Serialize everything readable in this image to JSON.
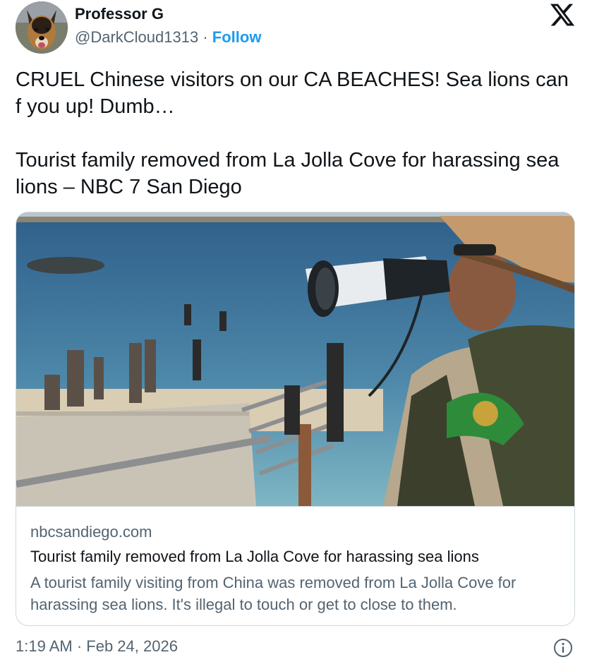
{
  "author": {
    "display_name": "Professor G",
    "handle": "@DarkCloud1313",
    "separator": "·",
    "follow_label": "Follow"
  },
  "tweet": {
    "line1": "CRUEL Chinese visitors on our CA BEACHES! Sea lions can f you up! Dumb…",
    "line2": "Tourist family removed from La Jolla Cove for harassing sea lions – NBC 7 San Diego",
    "timestamp": "1:19 AM · Feb 24, 2026"
  },
  "card": {
    "domain": "nbcsandiego.com",
    "title": "Tourist family removed from La Jolla Cove for harassing sea lions",
    "description": "A tourist family visiting from China was removed from La Jolla Cove for harassing sea lions. It's illegal to touch or get to close to them."
  },
  "icons": {
    "platform_logo": "x-logo-icon",
    "info": "info-icon"
  },
  "colors": {
    "follow": "#1d9bf0",
    "secondary_text": "#536471",
    "primary_text": "#0f1419",
    "border": "#cfd9de"
  }
}
